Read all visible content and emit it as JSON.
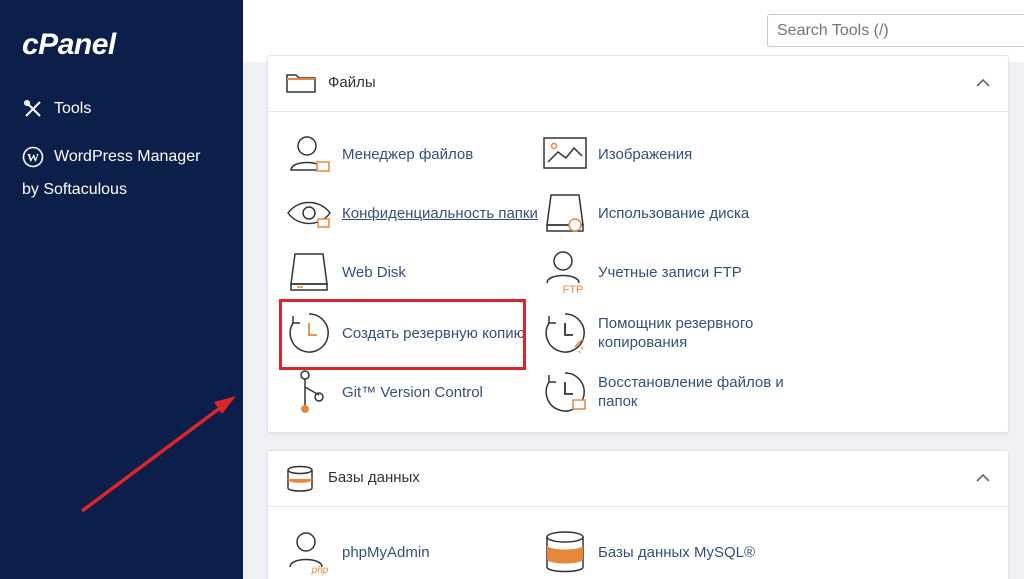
{
  "sidebar": {
    "logo": "cPanel",
    "items": [
      {
        "label": "Tools",
        "icon": "tools-icon"
      },
      {
        "label": "WordPress Manager",
        "icon": "wordpress-icon"
      }
    ],
    "wp_sub": "by Softaculous"
  },
  "search": {
    "placeholder": "Search Tools (/)"
  },
  "files_section": {
    "title": "Файлы",
    "tools": [
      {
        "label": "Менеджер файлов",
        "icon": "file-manager-icon"
      },
      {
        "label": "Изображения",
        "icon": "images-icon"
      },
      {
        "label": "Конфиденциальность папки",
        "icon": "directory-privacy-icon"
      },
      {
        "label": "Использование диска",
        "icon": "disk-usage-icon"
      },
      {
        "label": "Web Disk",
        "icon": "web-disk-icon"
      },
      {
        "label": "Учетные записи FTP",
        "icon": "ftp-accounts-icon"
      },
      {
        "label": "Создать резервную копию",
        "icon": "backup-icon"
      },
      {
        "label_line1": "Помощник резервного",
        "label_line2": "копирования",
        "icon": "backup-wizard-icon"
      },
      {
        "label": "Git™ Version Control",
        "icon": "git-icon"
      },
      {
        "label_line1": "Восстановление файлов и",
        "label_line2": "папок",
        "icon": "file-restoration-icon"
      }
    ]
  },
  "db_section": {
    "title": "Базы данных",
    "tools": [
      {
        "label": "phpMyAdmin",
        "icon": "phpmyadmin-icon"
      },
      {
        "label": "Базы данных MySQL®",
        "icon": "mysql-databases-icon"
      }
    ]
  },
  "colors": {
    "sidebar": "#0c1f4b",
    "highlight": "#d9262b",
    "link": "#34507a",
    "accent": "#e6883a"
  }
}
